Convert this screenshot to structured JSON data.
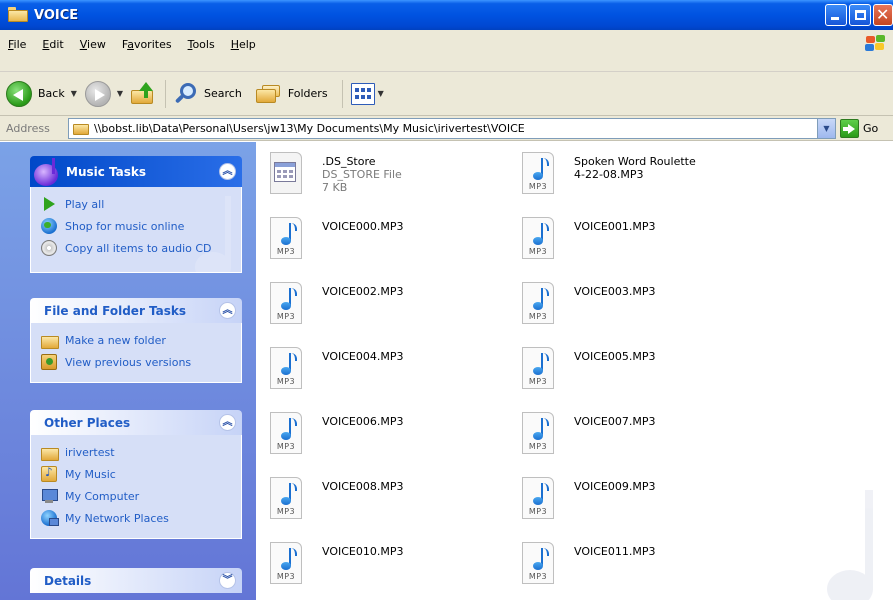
{
  "window": {
    "title": "VOICE"
  },
  "menu": {
    "items": [
      {
        "u": "F",
        "rest": "ile"
      },
      {
        "u": "E",
        "rest": "dit"
      },
      {
        "u": "V",
        "rest": "iew"
      },
      {
        "pre": "F",
        "u": "a",
        "rest": "vorites"
      },
      {
        "u": "T",
        "rest": "ools"
      },
      {
        "u": "H",
        "rest": "elp"
      }
    ]
  },
  "toolbar": {
    "back_label": "Back",
    "search_label": "Search",
    "folders_label": "Folders"
  },
  "address": {
    "label": "Address",
    "path": "\\\\bobst.lib\\Data\\Personal\\Users\\jw13\\My Documents\\My Music\\irivertest\\VOICE",
    "go_label": "Go"
  },
  "sidebar": {
    "music_tasks": {
      "title": "Music Tasks",
      "items": [
        "Play all",
        "Shop for music online",
        "Copy all items to audio CD"
      ]
    },
    "file_folder_tasks": {
      "title": "File and Folder Tasks",
      "items": [
        "Make a new folder",
        "View previous versions"
      ]
    },
    "other_places": {
      "title": "Other Places",
      "items": [
        "irivertest",
        "My Music",
        "My Computer",
        "My Network Places"
      ]
    },
    "details": {
      "title": "Details"
    }
  },
  "files": [
    {
      "name": ".DS_Store",
      "type": "DS_STORE File",
      "size": "7 KB",
      "icon": "generic-file-icon"
    },
    {
      "name": "Spoken Word Roulette",
      "name2": "4-22-08.MP3",
      "icon": "mp3-file-icon"
    },
    {
      "name": "VOICE000.MP3",
      "icon": "mp3-file-icon"
    },
    {
      "name": "VOICE001.MP3",
      "icon": "mp3-file-icon"
    },
    {
      "name": "VOICE002.MP3",
      "icon": "mp3-file-icon"
    },
    {
      "name": "VOICE003.MP3",
      "icon": "mp3-file-icon"
    },
    {
      "name": "VOICE004.MP3",
      "icon": "mp3-file-icon"
    },
    {
      "name": "VOICE005.MP3",
      "icon": "mp3-file-icon"
    },
    {
      "name": "VOICE006.MP3",
      "icon": "mp3-file-icon"
    },
    {
      "name": "VOICE007.MP3",
      "icon": "mp3-file-icon"
    },
    {
      "name": "VOICE008.MP3",
      "icon": "mp3-file-icon"
    },
    {
      "name": "VOICE009.MP3",
      "icon": "mp3-file-icon"
    },
    {
      "name": "VOICE010.MP3",
      "icon": "mp3-file-icon"
    },
    {
      "name": "VOICE011.MP3",
      "icon": "mp3-file-icon"
    }
  ],
  "mp3_ext_label": "MP3",
  "colors": {
    "titlebar": "#0053e1",
    "sidepanel_top": "#7ba2e7",
    "sidepanel_bottom": "#6375d6",
    "task_link": "#215dc6"
  }
}
